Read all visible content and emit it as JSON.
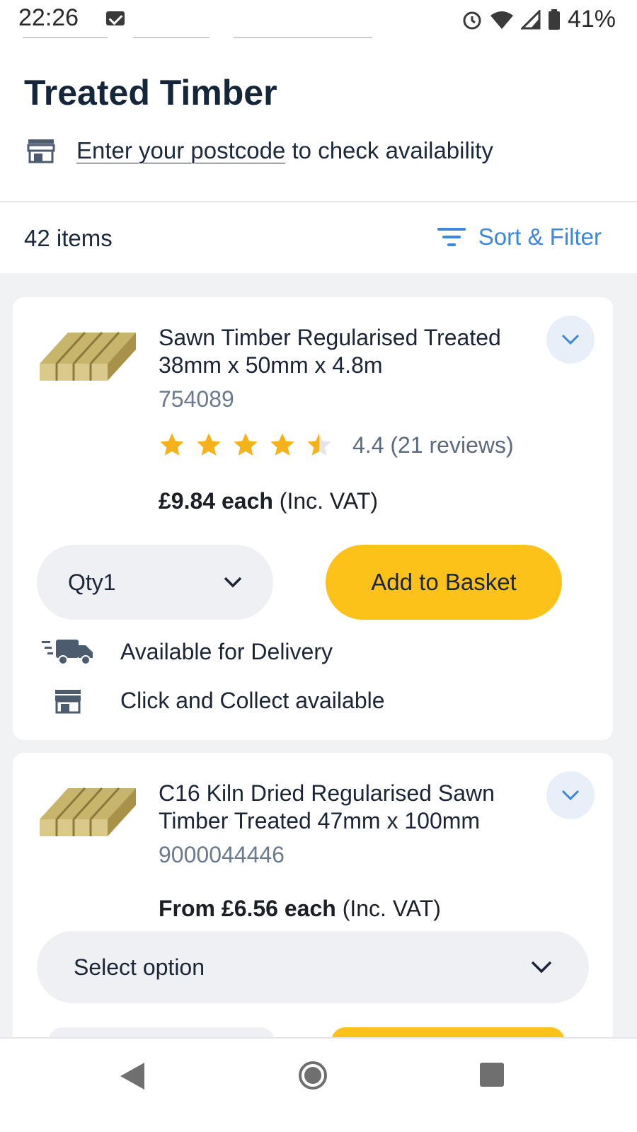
{
  "status_bar": {
    "time": "22:26",
    "battery_percent": "41%",
    "icons": [
      "mail-icon",
      "alarm-icon",
      "wifi-icon",
      "signal-icon",
      "battery-icon"
    ]
  },
  "header": {
    "title": "Treated Timber",
    "postcode_link": "Enter your postcode",
    "postcode_suffix": "to check availability",
    "store_icon": "store-icon"
  },
  "toolbar": {
    "items_count": "42 items",
    "sort_filter_label": "Sort & Filter"
  },
  "products": [
    {
      "title_line1": "Sawn Timber Regularised Treated",
      "title_line2": "38mm x 50mm x 4.8m",
      "code": "754089",
      "rating": 4.4,
      "rating_text": "4.4 (21 reviews)",
      "price_bold": "£9.84 each",
      "price_suffix": "(Inc. VAT)",
      "qty_label": "Qty1",
      "add_label": "Add to Basket",
      "delivery_text": "Available for Delivery",
      "collect_text": "Click and Collect available"
    },
    {
      "title_line1": "C16 Kiln Dried Regularised Sawn",
      "title_line2": "Timber Treated 47mm x 100mm",
      "code": "9000044446",
      "price_bold": "From £6.56 each",
      "price_suffix": "(Inc. VAT)",
      "select_label": "Select option"
    }
  ],
  "colors": {
    "accent_blue": "#3d86d8",
    "basket_yellow": "#fcc21a",
    "star": "#f6b21a",
    "title_navy": "#15253a"
  }
}
